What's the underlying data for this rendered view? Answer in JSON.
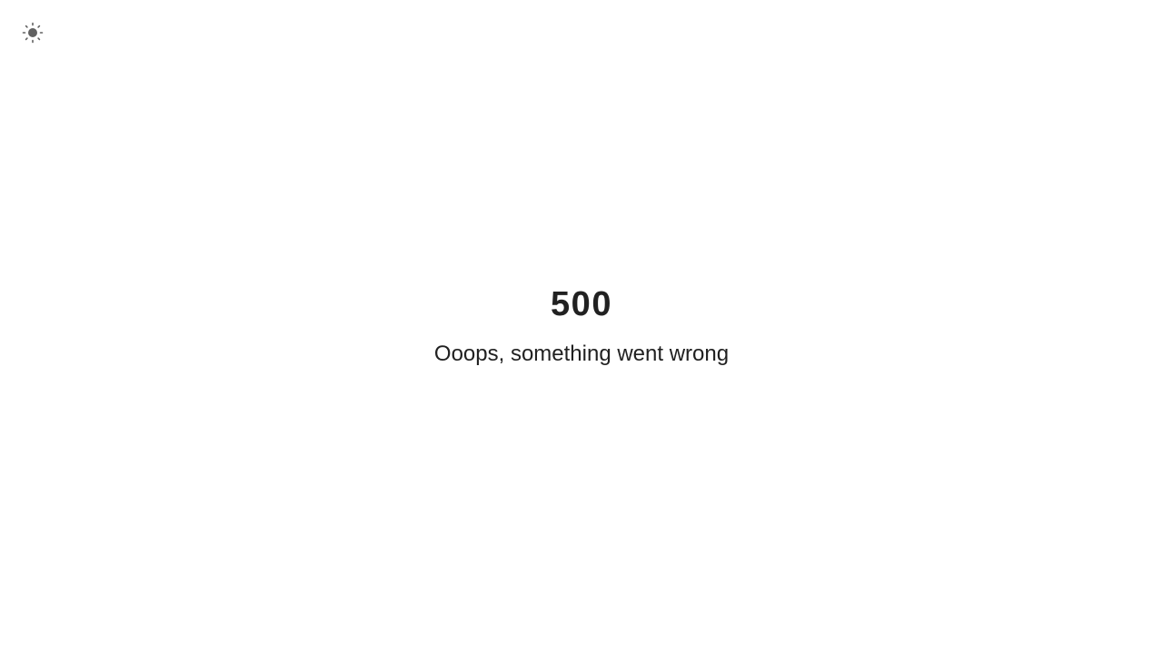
{
  "theme_toggle": {
    "icon": "sun-icon",
    "icon_color": "#616161"
  },
  "error": {
    "code": "500",
    "message": "Ooops, something went wrong"
  },
  "colors": {
    "background": "#ffffff",
    "text": "#212121"
  }
}
